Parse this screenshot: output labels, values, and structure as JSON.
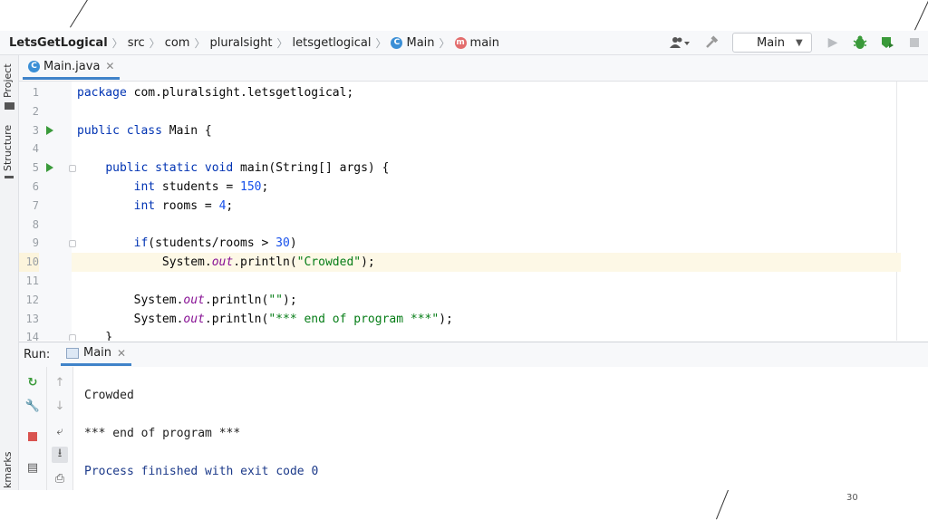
{
  "breadcrumb": {
    "project": "LetsGetLogical",
    "items": [
      "src",
      "com",
      "pluralsight",
      "letsgetlogical",
      "Main",
      "main"
    ]
  },
  "toolbar": {
    "run_config": "Main"
  },
  "left_strip": {
    "project_label": "Project",
    "structure_label": "Structure",
    "bookmarks_label": "kmarks"
  },
  "editor": {
    "tab_label": "Main.java",
    "lines": [
      {
        "num": "1",
        "text": "package com.pluralsight.letsgetlogical;"
      },
      {
        "num": "2",
        "text": ""
      },
      {
        "num": "3",
        "text": "public class Main {"
      },
      {
        "num": "4",
        "text": ""
      },
      {
        "num": "5",
        "text": "    public static void main(String[] args) {"
      },
      {
        "num": "6",
        "text": "        int students = 150;"
      },
      {
        "num": "7",
        "text": "        int rooms = 4;"
      },
      {
        "num": "8",
        "text": ""
      },
      {
        "num": "9",
        "text": "        if(students/rooms > 30)"
      },
      {
        "num": "10",
        "text": "            System.out.println(\"Crowded\");"
      },
      {
        "num": "11",
        "text": ""
      },
      {
        "num": "12",
        "text": "        System.out.println(\"\");"
      },
      {
        "num": "13",
        "text": "        System.out.println(\"*** end of program ***\");"
      },
      {
        "num": "14",
        "text": "    }"
      }
    ],
    "highlighted_line": "10"
  },
  "run_panel": {
    "label": "Run:",
    "tab_label": "Main",
    "output": [
      "Crowded",
      "",
      "*** end of program ***",
      "",
      "Process finished with exit code 0"
    ]
  },
  "slide_number": "30",
  "colors": {
    "keyword": "#0033b3",
    "number": "#1750eb",
    "string": "#067d17",
    "static_field": "#871094",
    "accent": "#4083c9"
  }
}
